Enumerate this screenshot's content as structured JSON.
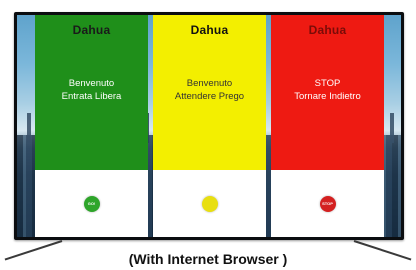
{
  "panels": [
    {
      "brand": "Dahua",
      "line1": "Benvenuto",
      "line2": "Entrata Libera",
      "badge": "GO!",
      "bg": "#1f8f1a",
      "text_color": "#ffffff",
      "brand_color": "#1a1a1a",
      "badge_color": "#2ea52a",
      "icon": "go-badge-icon"
    },
    {
      "brand": "Dahua",
      "line1": "Benvenuto",
      "line2": "Attendere Prego",
      "badge": "",
      "bg": "#f3ef00",
      "text_color": "#333333",
      "brand_color": "#111111",
      "badge_color": "#e8df10",
      "icon": "wait-badge-icon"
    },
    {
      "brand": "Dahua",
      "line1": "STOP",
      "line2": "Tornare Indietro",
      "badge": "STOP",
      "bg": "#ee1a12",
      "text_color": "#ffffff",
      "brand_color": "#7a0c08",
      "badge_color": "#d42020",
      "icon": "stop-sign-icon"
    }
  ],
  "caption": "(With Internet Browser )"
}
